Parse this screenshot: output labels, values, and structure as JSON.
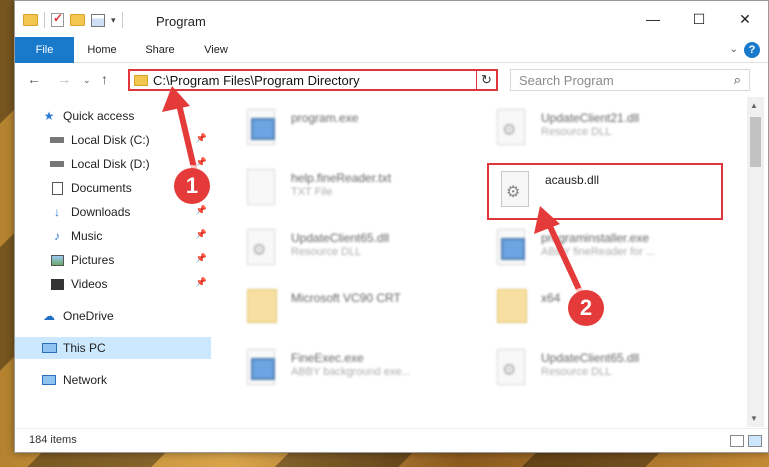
{
  "window": {
    "title": "Program"
  },
  "ribbon": {
    "tabs": [
      "File",
      "Home",
      "Share",
      "View"
    ]
  },
  "address": {
    "path": "C:\\Program Files\\Program Directory"
  },
  "search": {
    "placeholder": "Search Program"
  },
  "sidebar": {
    "items": [
      {
        "label": "Quick access",
        "icon": "star-icon",
        "pinned": false
      },
      {
        "label": "Local Disk (C:)",
        "icon": "drive-icon",
        "pinned": true
      },
      {
        "label": "Local Disk (D:)",
        "icon": "drive-icon",
        "pinned": true
      },
      {
        "label": "Documents",
        "icon": "documents-icon",
        "pinned": true
      },
      {
        "label": "Downloads",
        "icon": "download-icon",
        "pinned": true
      },
      {
        "label": "Music",
        "icon": "music-icon",
        "pinned": true
      },
      {
        "label": "Pictures",
        "icon": "pictures-icon",
        "pinned": true
      },
      {
        "label": "Videos",
        "icon": "videos-icon",
        "pinned": true
      },
      {
        "label": "OneDrive",
        "icon": "cloud-icon",
        "pinned": false
      },
      {
        "label": "This PC",
        "icon": "computer-icon",
        "pinned": false
      },
      {
        "label": "Network",
        "icon": "network-icon",
        "pinned": false
      }
    ]
  },
  "files": [
    {
      "name": "program.exe",
      "type": "",
      "icon": "program-icon"
    },
    {
      "name": "UpdateClient21.dll",
      "type": "Resource DLL",
      "icon": "dll-icon"
    },
    {
      "name": "help.fineReader.txt",
      "type": "TXT File",
      "icon": "text-file-icon"
    },
    {
      "name": "acausb.dll",
      "type": "",
      "icon": "dll-gear-icon"
    },
    {
      "name": "UpdateClient65.dll",
      "type": "Resource DLL",
      "icon": "dll-icon"
    },
    {
      "name": "programinstaller.exe",
      "type": "ABBY fineReader for ...",
      "icon": "installer-icon"
    },
    {
      "name": "Microsoft VC90 CRT",
      "type": "",
      "icon": "folder-icon"
    },
    {
      "name": "x64",
      "type": "",
      "icon": "folder-icon"
    },
    {
      "name": "FineExec.exe",
      "type": "ABBY background exe...",
      "icon": "exe-icon"
    },
    {
      "name": "UpdateClient65.dll",
      "type": "Resource DLL",
      "icon": "dll-icon"
    }
  ],
  "status": {
    "item_count": "184 items"
  },
  "callouts": [
    "1",
    "2"
  ],
  "colors": {
    "accent": "#1979ca",
    "highlight": "#e0353c",
    "selected": "#cce8ff"
  }
}
